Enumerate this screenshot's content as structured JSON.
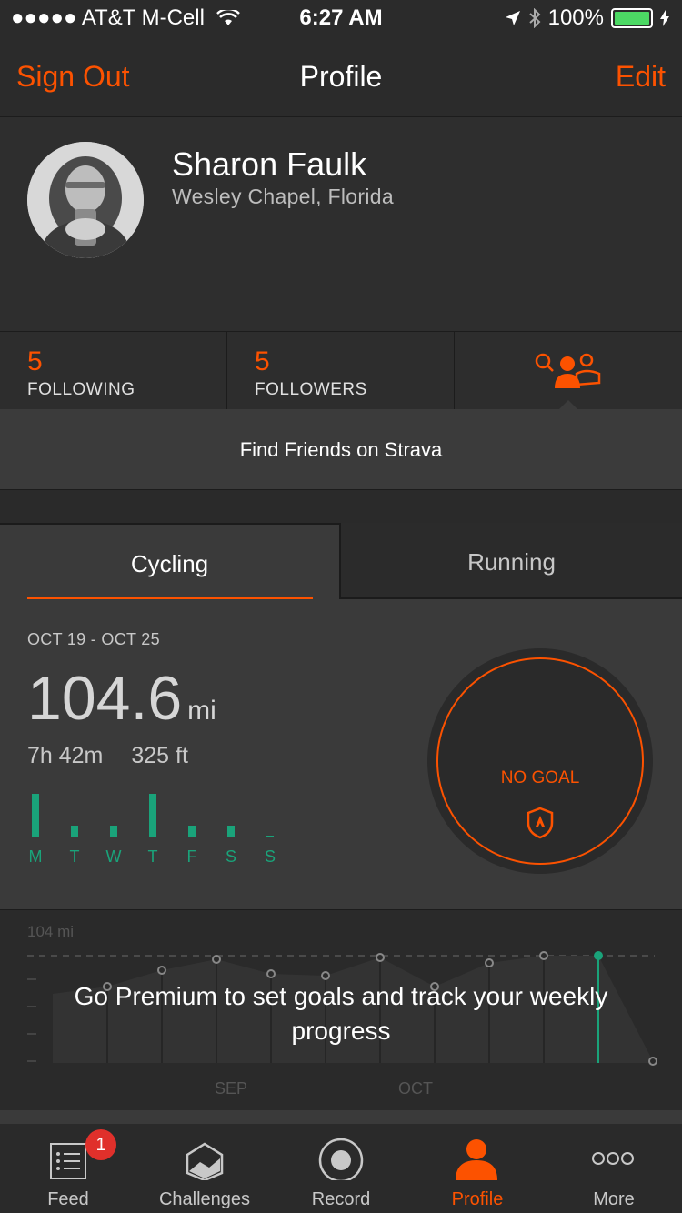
{
  "status_bar": {
    "carrier": "●●●●● AT&T M-Cell",
    "time": "6:27 AM",
    "battery": "100%",
    "icons": [
      "wifi-icon",
      "location-arrow-icon",
      "bluetooth-icon",
      "battery-icon",
      "charging-icon"
    ]
  },
  "nav": {
    "left": "Sign Out",
    "title": "Profile",
    "right": "Edit"
  },
  "profile": {
    "name": "Sharon Faulk",
    "location": "Wesley Chapel, Florida"
  },
  "follow": {
    "following_count": "5",
    "following_label": "FOLLOWING",
    "followers_count": "5",
    "followers_label": "FOLLOWERS"
  },
  "find_friends": "Find Friends on Strava",
  "tabs": {
    "cycling": "Cycling",
    "running": "Running"
  },
  "weekly": {
    "date_range": "OCT 19 - OCT 25",
    "distance": "104.6",
    "distance_unit": "mi",
    "time": "7h 42m",
    "elevation": "325 ft",
    "days": [
      "M",
      "T",
      "W",
      "T",
      "F",
      "S",
      "S"
    ],
    "day_activity": [
      1.0,
      0.28,
      0.28,
      1.0,
      0.28,
      0.28,
      0.05
    ],
    "goal_text": "NO GOAL"
  },
  "premium": {
    "axis_label": "104 mi",
    "message": "Go Premium to set goals and track your weekly progress",
    "month_labels": [
      "SEP",
      "OCT"
    ]
  },
  "colors": {
    "accent": "#fc5200",
    "activity_green": "#1aa37a",
    "badge_red": "#e0302b"
  },
  "tabbar": {
    "feed": "Feed",
    "feed_badge": "1",
    "challenges": "Challenges",
    "record": "Record",
    "profile": "Profile",
    "more": "More"
  }
}
